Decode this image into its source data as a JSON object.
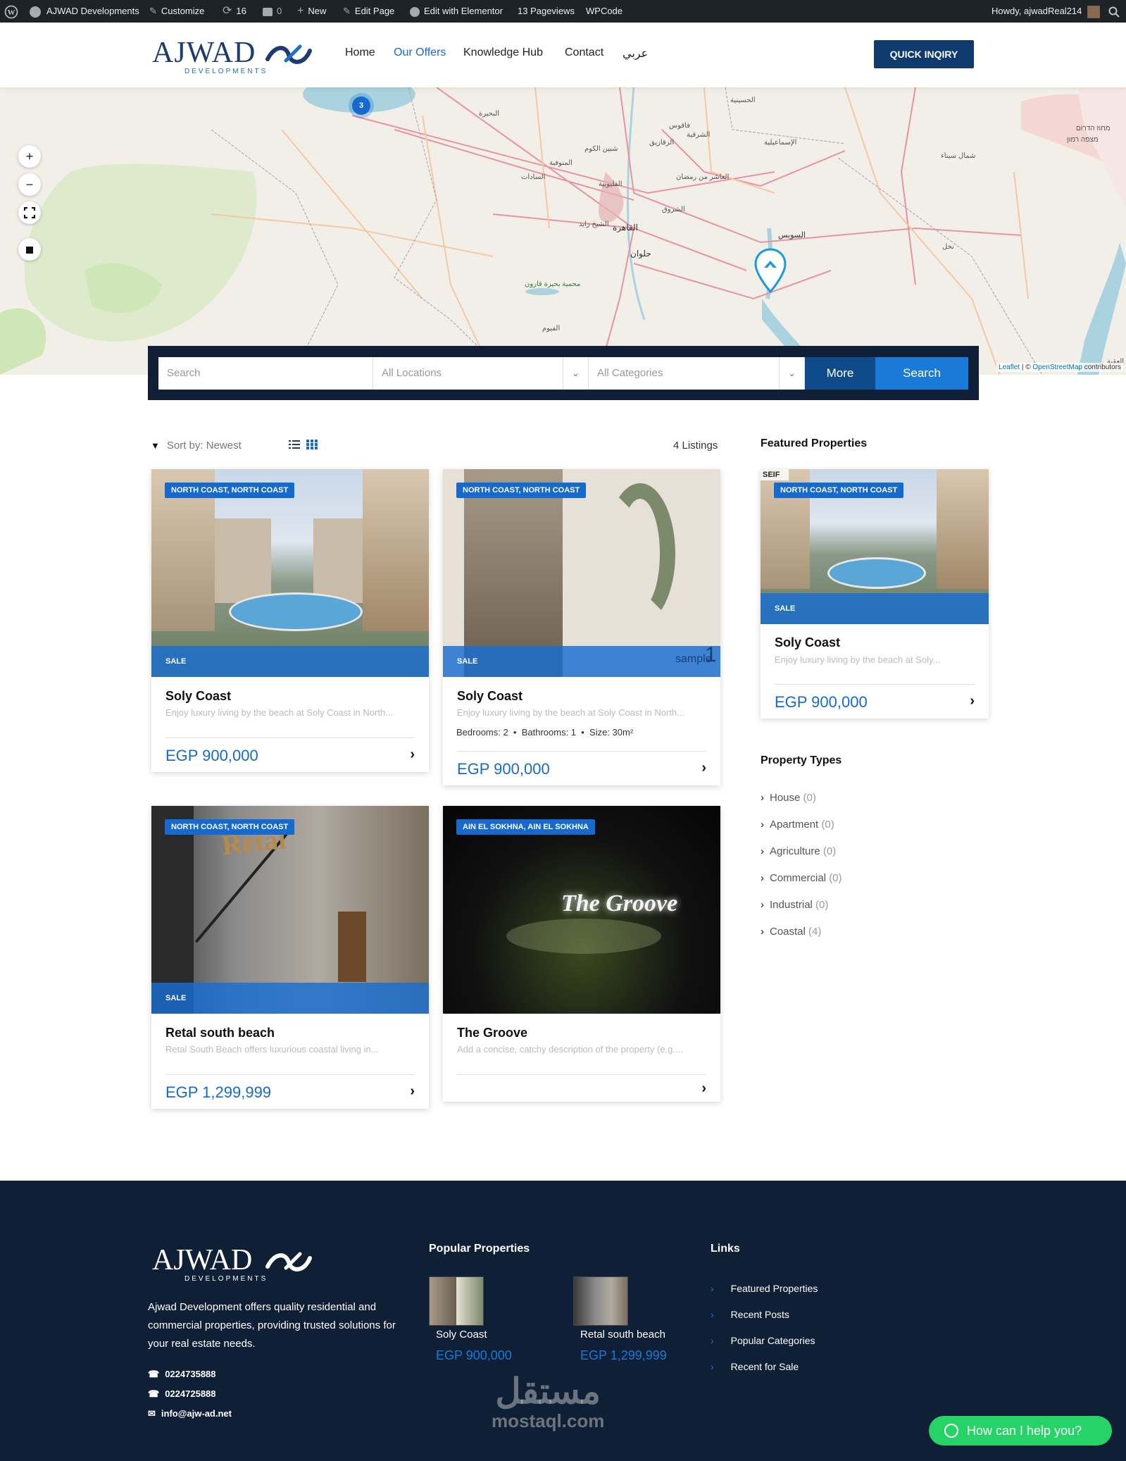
{
  "adminbar": {
    "site_name": "AJWAD Developments",
    "customize": "Customize",
    "updates": "16",
    "comments": "0",
    "new": "New",
    "edit_page": "Edit Page",
    "edit_elementor": "Edit with Elementor",
    "pageviews": "13 Pageviews",
    "wpcode": "WPCode",
    "howdy": "Howdy, ajwadReal214"
  },
  "header": {
    "logo_word": "AJWAD",
    "logo_sub": "DEVELOPMENTS",
    "nav": [
      {
        "label": "Home",
        "active": false
      },
      {
        "label": "Our Offers",
        "active": true
      },
      {
        "label": "Knowledge Hub",
        "active": false
      },
      {
        "label": "Contact",
        "active": false
      },
      {
        "label": "عربي",
        "active": false
      }
    ],
    "quick_inquiry": "QUICK INQIRY"
  },
  "map": {
    "cluster_count": "3",
    "zoom_in": "+",
    "zoom_out": "−",
    "attribution_leaflet": "Leaflet",
    "attribution_sep": " | © ",
    "attribution_osm": "OpenStreetMap",
    "attribution_tail": " contributors",
    "place_labels": [
      "القاهرة",
      "حلوان",
      "السويس",
      "الإسماعيلية",
      "الزقازيق",
      "شمال سيناء",
      "العاشر من رمضان",
      "الشروق",
      "الفيوم",
      "محمية بحيرة قارون",
      "البحيرة",
      "المنوفية",
      "السادات",
      "شبين الكوم",
      "القليوبية",
      "الشيخ زايد",
      "فاقوس",
      "الشرقية",
      "نخل",
      "العقبة",
      "מצפה רמון",
      "מחוז הדרום",
      "الحسينية"
    ]
  },
  "search": {
    "placeholder": "Search",
    "location": "All Locations",
    "category": "All Categories",
    "more": "More",
    "submit": "Search"
  },
  "listing": {
    "sort_label": "Sort by: Newest",
    "count": "4 Listings",
    "cards": [
      {
        "location": "NORTH COAST, NORTH COAST",
        "sale": "SALE",
        "title": "Soly Coast",
        "desc": "Enjoy luxury living by the beach at Soly Coast in North...",
        "price": "EGP 900,000"
      },
      {
        "location": "NORTH COAST, NORTH COAST",
        "sale": "SALE",
        "title": "Soly Coast",
        "desc": "Enjoy luxury living by the beach at Soly Coast in North...",
        "meta": [
          "Bedrooms: 2",
          "Bathrooms: 1",
          "Size: 30m²"
        ],
        "price": "EGP 900,000",
        "plan_label": "sample",
        "plan_num": "1"
      },
      {
        "location": "NORTH COAST, NORTH COAST",
        "sale": "SALE",
        "title": "Retal south beach",
        "desc": "Retal South Beach offers luxurious coastal living in...",
        "price": "EGP 1,299,999",
        "sign": "Retal"
      },
      {
        "location": "AIN EL SOKHNA, AIN EL SOKHNA",
        "title": "The Groove",
        "desc": "Add a concise, catchy description of the property (e.g....",
        "sign": "The Groove"
      }
    ]
  },
  "sidebar": {
    "featured_heading": "Featured Properties",
    "featured": {
      "location": "NORTH COAST, NORTH COAST",
      "sale": "SALE",
      "title": "Soly Coast",
      "desc": "Enjoy luxury living by the beach at Soly...",
      "price": "EGP 900,000",
      "brand": "SEIF"
    },
    "types_heading": "Property Types",
    "types": [
      {
        "label": "House",
        "count": "(0)"
      },
      {
        "label": "Apartment",
        "count": "(0)"
      },
      {
        "label": "Agriculture",
        "count": "(0)"
      },
      {
        "label": "Commercial",
        "count": "(0)"
      },
      {
        "label": "Industrial",
        "count": "(0)"
      },
      {
        "label": "Coastal",
        "count": "(4)"
      }
    ]
  },
  "footer": {
    "about": "Ajwad Development offers quality residential and commercial properties, providing trusted solutions for your real estate needs.",
    "phone1": "0224735888",
    "phone2": "0224725888",
    "email": "info@ajw-ad.net",
    "popular_heading": "Popular Properties",
    "popular": [
      {
        "name": "Soly Coast",
        "price": "EGP 900,000"
      },
      {
        "name": "Retal south beach",
        "price": "EGP 1,299,999"
      }
    ],
    "links_heading": "Links",
    "links": [
      "Featured Properties",
      "Recent Posts",
      "Popular Categories",
      "Recent for Sale"
    ]
  },
  "whatsapp": "How can I help you?",
  "watermark": {
    "arabic": "مستقل",
    "latin": "mostaql.com"
  },
  "colors": {
    "primary": "#1669cf",
    "navy": "#0f1f35",
    "quick": "#0f3a6e",
    "whatsapp": "#25d366"
  }
}
